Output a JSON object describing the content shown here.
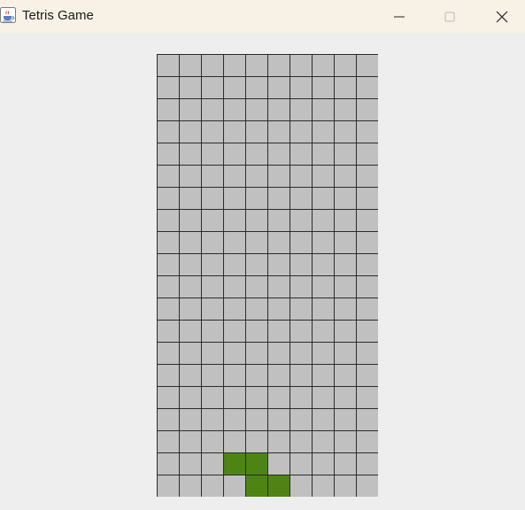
{
  "window": {
    "title": "Tetris Game",
    "icon": "java-coffee-icon",
    "controls": [
      "minimize-icon",
      "maximize-icon",
      "close-icon"
    ]
  },
  "board": {
    "columns": 10,
    "rows": 20,
    "empty_color": "#c0c0c0",
    "grid_line_color": "#2b2b2b",
    "piece": {
      "type": "Z",
      "color": "#4e8414",
      "cells": [
        [
          3,
          18
        ],
        [
          4,
          18
        ],
        [
          4,
          19
        ],
        [
          5,
          19
        ]
      ]
    }
  },
  "colors": {
    "titlebar": "#f8f1e6",
    "background": "#eeeeee"
  }
}
